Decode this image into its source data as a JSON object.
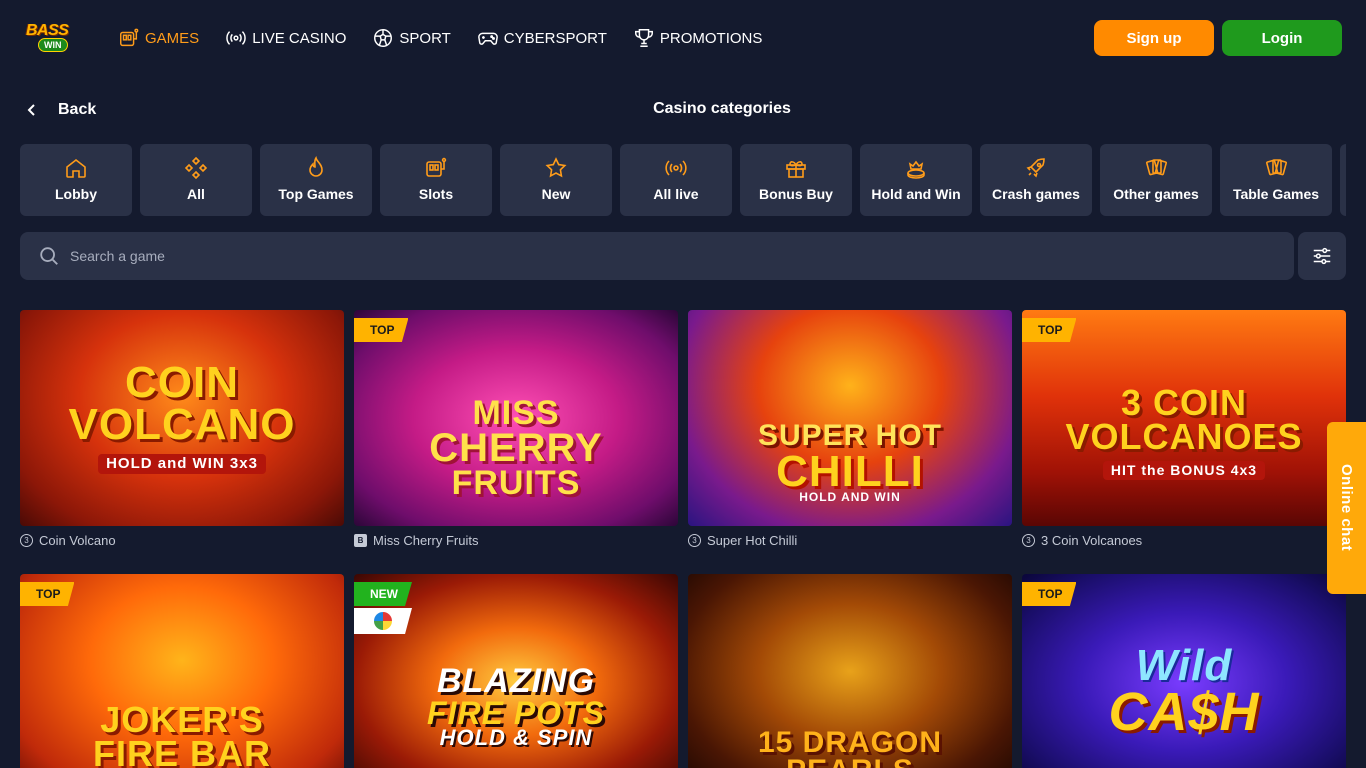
{
  "brand": {
    "logo_top": "BASS",
    "logo_bottom": "WIN"
  },
  "nav": [
    {
      "label": "GAMES",
      "icon": "slot-machine-icon",
      "active": true
    },
    {
      "label": "LIVE CASINO",
      "icon": "broadcast-icon",
      "active": false
    },
    {
      "label": "SPORT",
      "icon": "soccer-ball-icon",
      "active": false
    },
    {
      "label": "CYBERSPORT",
      "icon": "gamepad-icon",
      "active": false
    },
    {
      "label": "PROMOTIONS",
      "icon": "trophy-icon",
      "active": false
    }
  ],
  "auth": {
    "signup_label": "Sign up",
    "login_label": "Login"
  },
  "page": {
    "back_label": "Back",
    "title": "Casino categories"
  },
  "categories": [
    {
      "label": "Lobby",
      "icon": "home-icon"
    },
    {
      "label": "All",
      "icon": "diamond-grid-icon"
    },
    {
      "label": "Top Games",
      "icon": "flame-icon"
    },
    {
      "label": "Slots",
      "icon": "slot-machine-icon"
    },
    {
      "label": "New",
      "icon": "star-icon"
    },
    {
      "label": "All live",
      "icon": "broadcast-icon"
    },
    {
      "label": "Bonus Buy",
      "icon": "gift-icon"
    },
    {
      "label": "Hold and Win",
      "icon": "crown-coin-icon"
    },
    {
      "label": "Crash games",
      "icon": "rocket-icon"
    },
    {
      "label": "Other games",
      "icon": "cards-icon"
    },
    {
      "label": "Table Games",
      "icon": "cards-icon"
    }
  ],
  "search": {
    "placeholder": "Search a game"
  },
  "games": [
    {
      "title": "Coin Volcano",
      "badge": "",
      "provider_mark": "3",
      "art_line1": "COIN",
      "art_line2": "VOLCANO",
      "art_line3": "HOLD and WIN 3x3"
    },
    {
      "title": "Miss Cherry Fruits",
      "badge": "TOP",
      "provider_mark": "B",
      "art_line1": "MISS",
      "art_line2": "CHERRY",
      "art_line3": "FRUITS"
    },
    {
      "title": "Super Hot Chilli",
      "badge": "",
      "provider_mark": "3",
      "art_line1": "SUPER HOT",
      "art_line2": "CHILLI",
      "art_line3": "HOLD AND WIN"
    },
    {
      "title": "3 Coin Volcanoes",
      "badge": "TOP",
      "provider_mark": "3",
      "art_line1": "3 COIN",
      "art_line2": "VOLCANOES",
      "art_line3": "HIT the BONUS 4x3"
    },
    {
      "title": "",
      "badge": "TOP",
      "provider_mark": "",
      "art_line1": "JOKER'S",
      "art_line2": "FIRE BAR",
      "art_line3": ""
    },
    {
      "title": "",
      "badge": "NEW",
      "provider_mark": "",
      "art_line1": "BLAZING",
      "art_line2": "FIRE POTS",
      "art_line3": "HOLD & SPIN"
    },
    {
      "title": "",
      "badge": "",
      "provider_mark": "",
      "art_line1": "",
      "art_line2": "15 DRAGON",
      "art_line3": "PEARLS"
    },
    {
      "title": "",
      "badge": "TOP",
      "provider_mark": "",
      "art_line1": "Wild",
      "art_line2": "CA$H",
      "art_line3": ""
    }
  ],
  "online_chat": {
    "label": "Online chat"
  },
  "colors": {
    "background": "#141a2e",
    "panel": "#2a3147",
    "accent": "#ff9c1a",
    "signup": "#ff8a00",
    "login": "#1f9a1d",
    "badge_top": "#ffb300",
    "badge_new": "#22b31e"
  }
}
